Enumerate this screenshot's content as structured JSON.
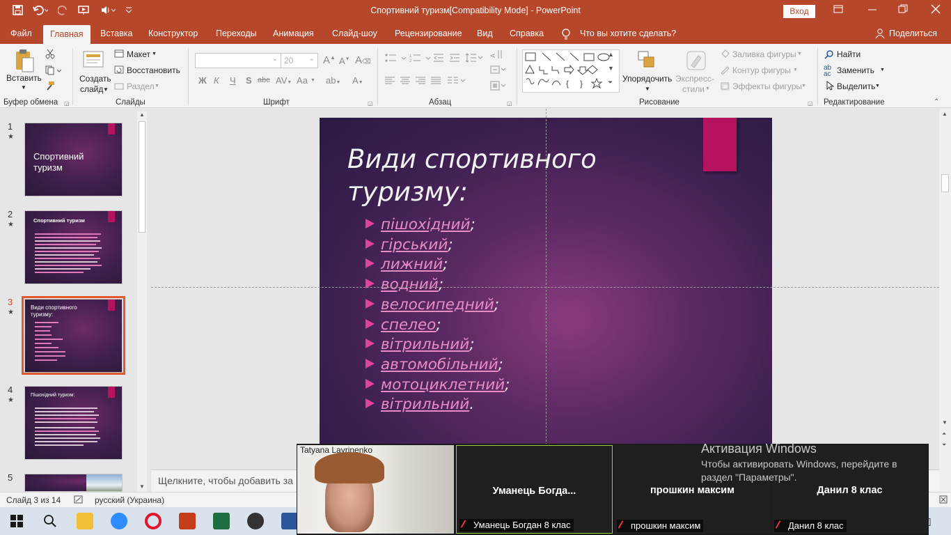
{
  "titlebar": {
    "doc_title": "Спортивний туризм[Compatibility Mode]  -  PowerPoint",
    "signin": "Вход"
  },
  "tabs": [
    {
      "label": "Файл"
    },
    {
      "label": "Главная"
    },
    {
      "label": "Вставка"
    },
    {
      "label": "Конструктор"
    },
    {
      "label": "Переходы"
    },
    {
      "label": "Анимация"
    },
    {
      "label": "Слайд-шоу"
    },
    {
      "label": "Рецензирование"
    },
    {
      "label": "Вид"
    },
    {
      "label": "Справка"
    }
  ],
  "tell_me": "Что вы хотите сделать?",
  "share": "Поделиться",
  "ribbon": {
    "clipboard": {
      "paste": "Вставить",
      "group": "Буфер обмена"
    },
    "slides": {
      "new_slide": "Создать",
      "new_slide2": "слайд",
      "layout": "Макет",
      "reset": "Восстановить",
      "section": "Раздел",
      "group": "Слайды"
    },
    "font": {
      "size": "20",
      "bold": "Ж",
      "italic": "К",
      "underline": "Ч",
      "shadow": "S",
      "strike": "abc",
      "case": "Аа",
      "group": "Шрифт"
    },
    "paragraph": {
      "group": "Абзац"
    },
    "drawing": {
      "arrange": "Упорядочить",
      "quick_styles": "Экспресс-",
      "quick_styles2": "стили",
      "fill": "Заливка фигуры",
      "outline": "Контур фигуры",
      "effects": "Эффекты фигуры",
      "group": "Рисование"
    },
    "editing": {
      "find": "Найти",
      "replace": "Заменить",
      "select": "Выделить",
      "group": "Редактирование"
    }
  },
  "thumbnails": [
    {
      "num": "1",
      "title": "Спортивний туризм"
    },
    {
      "num": "2",
      "title": "Спортивний туризм"
    },
    {
      "num": "3",
      "title": "Види спортивного туризму:"
    },
    {
      "num": "4",
      "title": "Пішохідний туризм:"
    },
    {
      "num": "5",
      "title": ""
    }
  ],
  "slide": {
    "title": "Види спортивного туризму:",
    "items": [
      {
        "link": "пішохідний",
        "punct": ";"
      },
      {
        "link": "гірський",
        "punct": ";"
      },
      {
        "link": "лижний",
        "punct": ";"
      },
      {
        "link": "водний",
        "punct": ";"
      },
      {
        "link": "велосипедний",
        "punct": ";"
      },
      {
        "link": "спелео",
        "punct": ";"
      },
      {
        "link": "вітрильний",
        "punct": ";"
      },
      {
        "link": "автомобільний",
        "punct": ";"
      },
      {
        "link": "мотоциклетний",
        "punct": ";"
      },
      {
        "link": "вітрильний",
        "punct": "."
      }
    ]
  },
  "notes": {
    "placeholder": "Щелкните, чтобы добавить за"
  },
  "status": {
    "slide": "Слайд 3 из 14",
    "lang": "русский (Украина)"
  },
  "zoom": {
    "tiles": [
      {
        "caption": "Tatyana Lavrinenko",
        "name": ""
      },
      {
        "caption": "Уманець Богдан 8 клас",
        "name": "Уманець  Богда..."
      },
      {
        "caption": "прошкин максим",
        "name": "прошкин максим"
      },
      {
        "caption": "Данил 8 клас",
        "name": "Данил 8 клас"
      }
    ]
  },
  "activation": {
    "title": "Активация Windows",
    "line1": "Чтобы активировать Windows, перейдите в",
    "line2": "раздел \"Параметры\"."
  },
  "colors": {
    "accent": "#b7472a",
    "slide_accent": "#b5135f",
    "selection": "#e0592f"
  }
}
